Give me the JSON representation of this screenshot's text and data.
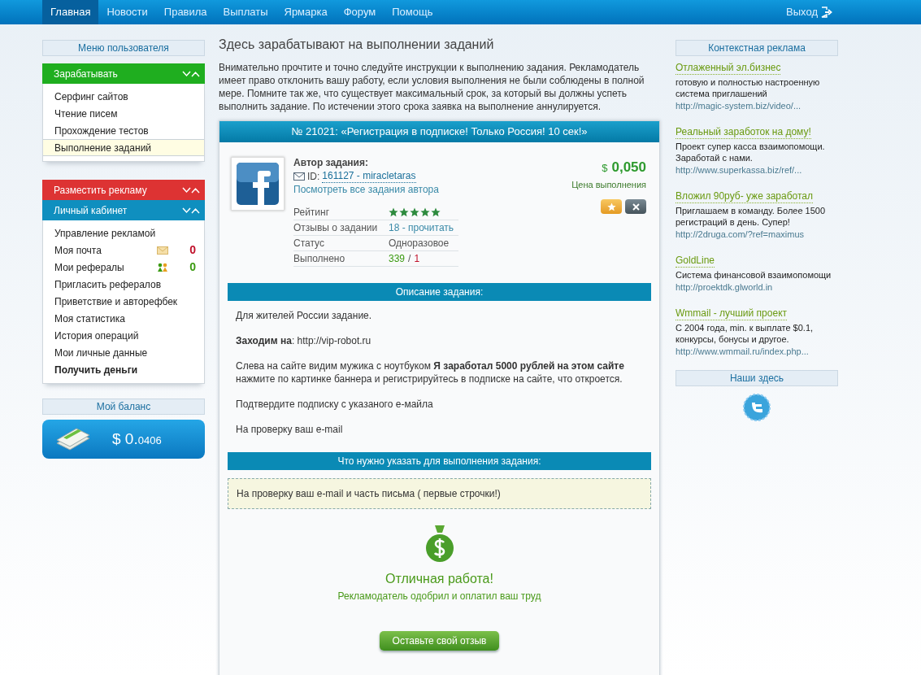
{
  "nav": {
    "items": [
      {
        "label": "Главная",
        "selected": true
      },
      {
        "label": "Новости",
        "selected": false
      },
      {
        "label": "Правила",
        "selected": false
      },
      {
        "label": "Выплаты",
        "selected": false
      },
      {
        "label": "Ярмарка",
        "selected": false
      },
      {
        "label": "Форум",
        "selected": false
      },
      {
        "label": "Помощь",
        "selected": false
      }
    ],
    "logout": "Выход"
  },
  "sidebar": {
    "title": "Меню пользователя",
    "groups": [
      {
        "title": "Зарабатывать",
        "color": "#1fae1f",
        "items": [
          {
            "label": "Серфинг сайтов",
            "selected": false
          },
          {
            "label": "Чтение писем",
            "selected": false
          },
          {
            "label": "Прохождение тестов",
            "selected": false
          },
          {
            "label": "Выполнение заданий",
            "selected": true
          }
        ]
      },
      {
        "title": "Разместить рекламу",
        "color": "#dd3333"
      },
      {
        "title": "Личный кабинет",
        "color": "#0f8fbf",
        "items": [
          {
            "label": "Управление рекламой",
            "selected": false
          },
          {
            "label": "Моя почта",
            "selected": false,
            "kind": "mail",
            "count": "0",
            "color": "#c0102a"
          },
          {
            "label": "Мои рефералы",
            "selected": false,
            "kind": "referrals",
            "count": "0",
            "color": "#3a9a10"
          },
          {
            "label": "Пригласить рефералов",
            "selected": false
          },
          {
            "label": "Приветствие и авторефбек",
            "selected": false
          },
          {
            "label": "Моя статистика",
            "selected": false
          },
          {
            "label": "История операций",
            "selected": false
          },
          {
            "label": "Мои личные данные",
            "selected": false
          },
          {
            "label": "Получить деньги",
            "selected": false,
            "bold": true
          }
        ]
      }
    ],
    "balance": {
      "title": "Мой баланс",
      "value": "$ 0.",
      "fraction": "0406"
    }
  },
  "main": {
    "title": "Здесь зарабатывают на выполнении заданий",
    "intro": "Внимательно прочтите и точно следуйте инструкции к выполнению задания. Рекламодатель имеет право отклонить вашу работу, если условия выполнения не были соблюдены в полной мере. Помните так же, что существует максимальный срок, за который вы должны успеть выполнить задание. По истечении этого срока заявка на выполнение аннулируется.",
    "task": {
      "header": "№ 21021: «Регистрация в подписке! Только Россия! 10 сек!»",
      "author_label": "Автор задания:",
      "id_label": "ID:",
      "id_link": "161127 - miracletaras",
      "all_tasks_link": "Посмотреть все задания автора",
      "price_currency": "$",
      "price": "0,050",
      "price_label": "Цена выполнения",
      "stats": [
        {
          "label": "Рейтинг",
          "kind": "stars",
          "stars": 5
        },
        {
          "label": "Отзывы о задании",
          "kind": "link",
          "value": "18 - прочитать"
        },
        {
          "label": "Статус",
          "kind": "text",
          "value": "Одноразовое"
        },
        {
          "label": "Выполнено",
          "kind": "counts",
          "done": "339",
          "separator": "/",
          "rejected": "1"
        }
      ]
    },
    "description_title": "Описание задания:",
    "description": [
      "Для жителей России задание.",
      "**Заходим на**: http://vip-robot.ru",
      "Слева на сайте видим мужика с ноутбуком **Я заработал 5000 рублей на этом сайте** нажмите по картинке баннера и регистрируйтесь в подписке на сайте, что откроется.",
      "Подтвердите подписку с указаного е-майла",
      "На проверку ваш e-mail"
    ],
    "requirement_title": "Что нужно указать для выполнения задания:",
    "requirement": "На проверку ваш e-mail и часть письма ( первые строчки!)",
    "result": {
      "title": "Отличная работа!",
      "subtitle": "Рекламодатель одобрил и оплатил ваш труд"
    },
    "review_button": "Оставьте свой отзыв"
  },
  "ads": {
    "title": "Контекстная реклама",
    "items": [
      {
        "title": "Отлаженный эл.бизнес",
        "text": "готовую и полностью настроенную система приглашений",
        "url": "http://magic-system.biz/video/..."
      },
      {
        "title": "Реальный заработок на дому!",
        "text": "Проект супер касса взаимопомощи. Заработай с нами.",
        "url": "http://www.superkassa.biz/ref/..."
      },
      {
        "title": "Вложил 90руб- уже заработал",
        "text": "Приглашаем в команду. Более 1500 регистраций в день. Супер!",
        "url": "http://2druga.com/?ref=maximus"
      },
      {
        "title": "GoldLine",
        "text": "Система финансовой взаимопомощи",
        "url": "http://proektdk.glworld.in"
      },
      {
        "title": "Wmmail - лучший проект",
        "text": "С 2004 года, min. к выплате $0.1, конкурсы, бонусы и другое.",
        "url": "http://www.wmmail.ru/index.php..."
      }
    ],
    "social_title": "Наши здесь"
  }
}
